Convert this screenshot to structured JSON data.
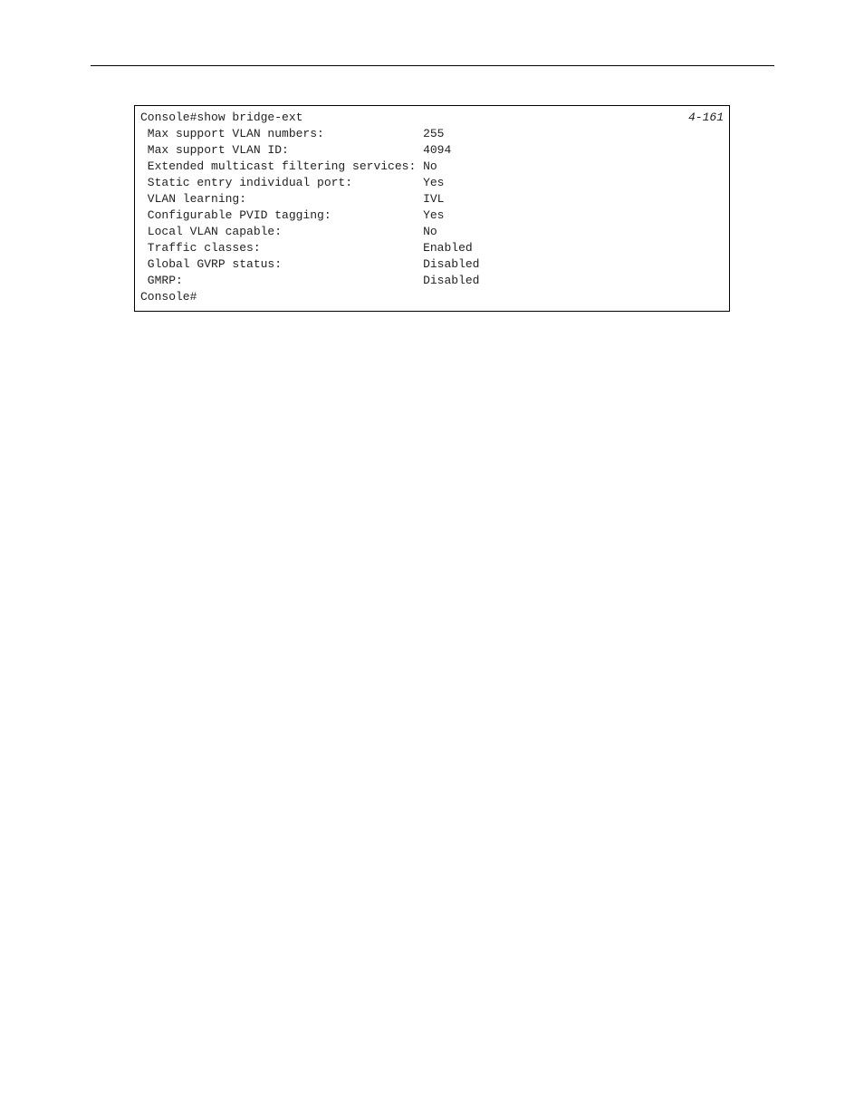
{
  "pageRef": "4-161",
  "console": {
    "promptStart": "Console#show bridge-ext",
    "promptEnd": "Console#",
    "rows": [
      {
        "label": " Max support VLAN numbers:              ",
        "value": "255"
      },
      {
        "label": " Max support VLAN ID:                   ",
        "value": "4094"
      },
      {
        "label": " Extended multicast filtering services: ",
        "value": "No"
      },
      {
        "label": " Static entry individual port:          ",
        "value": "Yes"
      },
      {
        "label": " VLAN learning:                         ",
        "value": "IVL"
      },
      {
        "label": " Configurable PVID tagging:             ",
        "value": "Yes"
      },
      {
        "label": " Local VLAN capable:                    ",
        "value": "No"
      },
      {
        "label": " Traffic classes:                       ",
        "value": "Enabled"
      },
      {
        "label": " Global GVRP status:                    ",
        "value": "Disabled"
      },
      {
        "label": " GMRP:                                  ",
        "value": "Disabled"
      }
    ]
  }
}
